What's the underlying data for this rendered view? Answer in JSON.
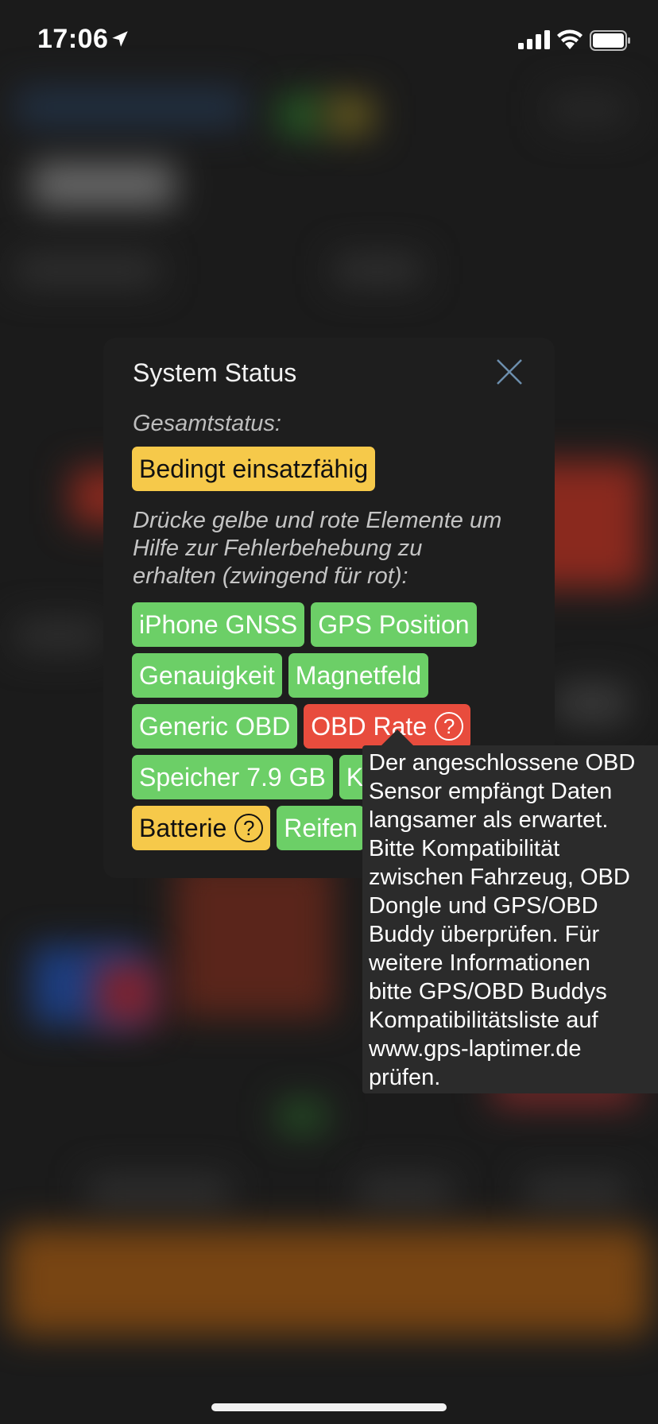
{
  "status_bar": {
    "time": "17:06",
    "icons": [
      "location-arrow-icon",
      "cellular-signal-icon",
      "wifi-icon",
      "battery-icon"
    ]
  },
  "popup": {
    "title": "System Status",
    "close_icon": "close-icon",
    "overall_label": "Gesamtstatus:",
    "overall_status": "Bedingt einsatzfähig",
    "hint": "Drücke gelbe und rote Elemente um Hilfe zur Fehlerbehebung zu erhalten (zwingend für rot):",
    "chip_rows": [
      [
        {
          "label": "iPhone GNSS",
          "status": "green"
        },
        {
          "label": "GPS Position",
          "status": "green"
        }
      ],
      [
        {
          "label": "Genauigkeit",
          "status": "green"
        },
        {
          "label": "Magnetfeld",
          "status": "green"
        }
      ],
      [
        {
          "label": "Generic OBD",
          "status": "green"
        },
        {
          "label": "OBD Rate",
          "status": "red",
          "help": "?"
        }
      ],
      [
        {
          "label": "Speicher 7.9 GB",
          "status": "green"
        },
        {
          "label": "K",
          "status": "green"
        }
      ],
      [
        {
          "label": "Batterie",
          "status": "yellow",
          "help": "?"
        },
        {
          "label": "Reifen",
          "status": "green"
        }
      ]
    ]
  },
  "tooltip": {
    "text": "Der angeschlossene OBD\nSensor empfängt Daten\nlangsamer als erwartet.\nBitte Kompatibilität\nzwischen Fahrzeug, OBD\nDongle und GPS/OBD\nBuddy überprüfen. Für\nweitere Informationen\nbitte GPS/OBD Buddys\nKompatibilitätsliste auf\nwww.gps-laptimer.de\nprüfen."
  },
  "colors": {
    "green": "#6ccf67",
    "red": "#e84c3d",
    "yellow": "#f6c94a",
    "popup_bg": "#1e1e1e",
    "tooltip_bg": "#2b2b2b"
  }
}
